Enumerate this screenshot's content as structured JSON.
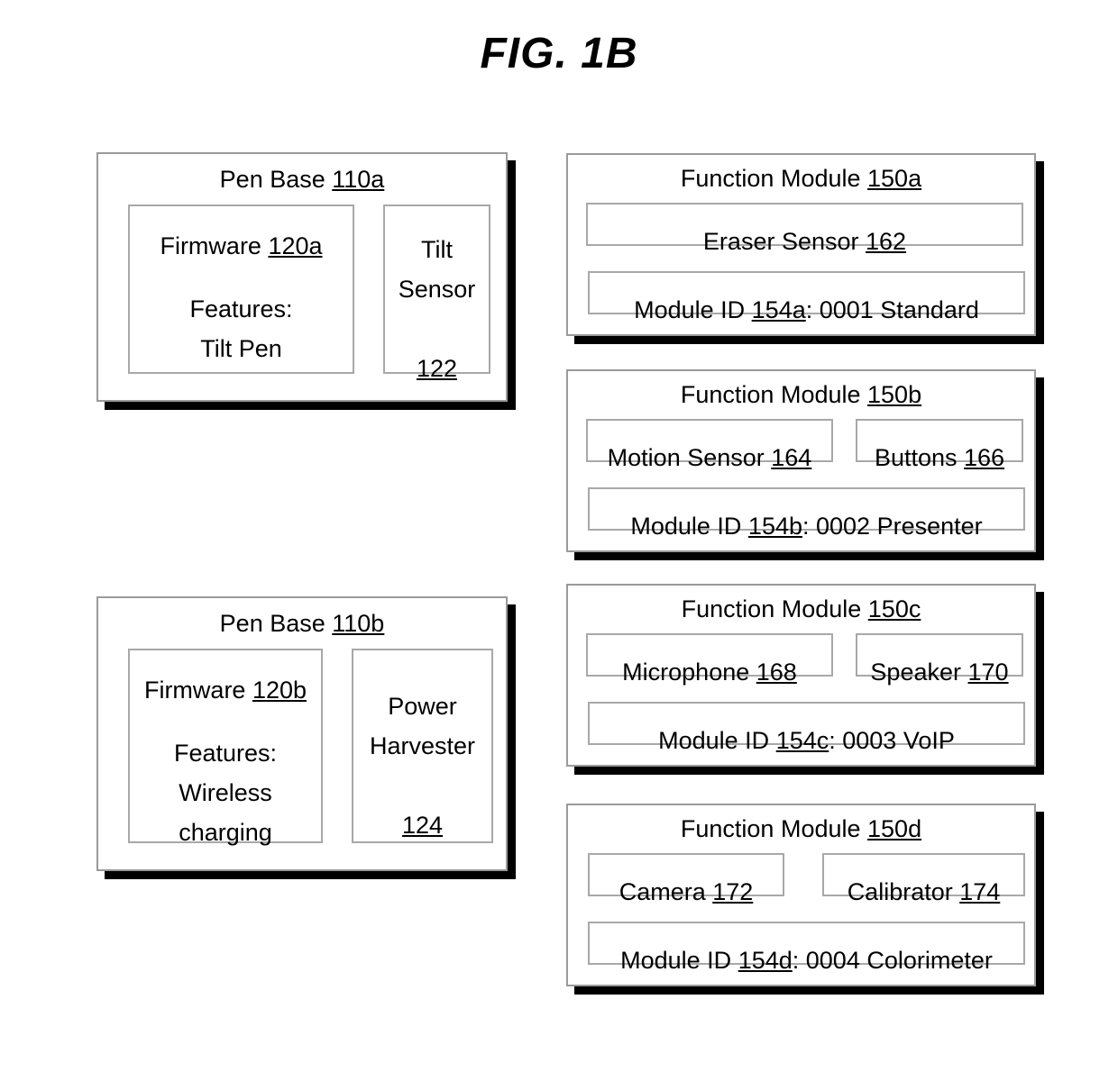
{
  "figure": {
    "title": "FIG. 1B"
  },
  "pen_bases": [
    {
      "title_text": "Pen Base ",
      "title_ref": "110a",
      "firmware": {
        "label": "Firmware ",
        "ref": "120a",
        "features_label": "Features:",
        "features_value": "Tilt Pen"
      },
      "component": {
        "label": "Tilt\nSensor",
        "ref": "122"
      }
    },
    {
      "title_text": "Pen Base ",
      "title_ref": "110b",
      "firmware": {
        "label": "Firmware ",
        "ref": "120b",
        "features_label": "Features:",
        "features_value": "Wireless\ncharging"
      },
      "component": {
        "label": "Power\nHarvester",
        "ref": "124"
      }
    }
  ],
  "function_modules": [
    {
      "title_text": "Function Module ",
      "title_ref": "150a",
      "components": [
        {
          "label": "Eraser Sensor ",
          "ref": "162"
        }
      ],
      "module_id": {
        "prefix": "Module ID ",
        "ref": "154a",
        "suffix": ": 0001 Standard"
      }
    },
    {
      "title_text": "Function Module ",
      "title_ref": "150b",
      "components": [
        {
          "label": "Motion Sensor ",
          "ref": "164"
        },
        {
          "label": "Buttons ",
          "ref": "166"
        }
      ],
      "module_id": {
        "prefix": "Module ID ",
        "ref": "154b",
        "suffix": ": 0002 Presenter"
      }
    },
    {
      "title_text": "Function Module ",
      "title_ref": "150c",
      "components": [
        {
          "label": "Microphone ",
          "ref": "168"
        },
        {
          "label": "Speaker ",
          "ref": "170"
        }
      ],
      "module_id": {
        "prefix": "Module ID ",
        "ref": "154c",
        "suffix": ": 0003 VoIP"
      }
    },
    {
      "title_text": "Function Module ",
      "title_ref": "150d",
      "components": [
        {
          "label": "Camera ",
          "ref": "172"
        },
        {
          "label": "Calibrator ",
          "ref": "174"
        }
      ],
      "module_id": {
        "prefix": "Module ID ",
        "ref": "154d",
        "suffix": ": 0004 Colorimeter"
      }
    }
  ],
  "colors": {
    "box_border": "#9a9a9a",
    "inner_border": "#a8a8a8",
    "shadow": "#000000",
    "text": "#000000",
    "background": "#ffffff"
  }
}
